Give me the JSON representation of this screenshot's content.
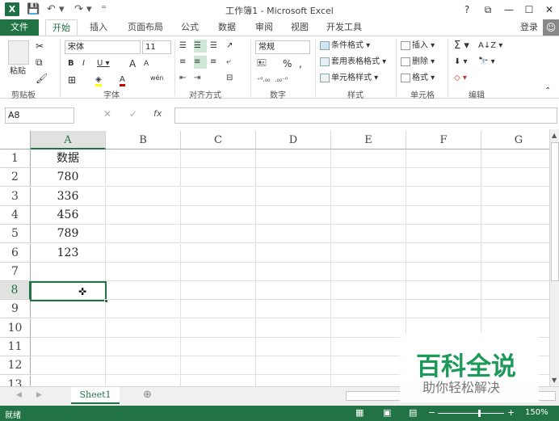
{
  "window": {
    "title": "工作簿1 - Microsoft Excel",
    "logo": "X",
    "help": "?",
    "restore": "⧉",
    "minimize": "—",
    "maximize": "☐",
    "close": "✕",
    "qa_save": "💾",
    "qa_undo": "↶ ▾",
    "qa_redo": "↷ ▾",
    "qa_more": "⁼"
  },
  "tabs": [
    "文件",
    "开始",
    "插入",
    "页面布局",
    "公式",
    "数据",
    "审阅",
    "视图",
    "开发工具"
  ],
  "login": "登录",
  "ribbon": {
    "paste": "粘贴",
    "clipboard": "剪贴板",
    "font_name": "宋体",
    "font_size": "11",
    "font_group": "字体",
    "bold": "B",
    "italic": "I",
    "underline": "U ▾",
    "grow": "A",
    "shrink": "A",
    "font_color": "A",
    "wen": "wén",
    "align_group": "对齐方式",
    "number_format": "常规",
    "number_group": "数字",
    "pct": "%",
    "comma": ",",
    "cond": "条件格式 ▾",
    "table": "套用表格格式 ▾",
    "cellstyle": "单元格样式 ▾",
    "styles_group": "样式",
    "insert": "插入 ▾",
    "delete": "删除 ▾",
    "format": "格式 ▾",
    "cells_group": "单元格",
    "sum": "Σ ▾",
    "sort": "A↓Z ▾",
    "find": "🔭 ▾",
    "fill": "⬇ ▾",
    "clear": "◇ ▾",
    "edit_group": "编辑"
  },
  "formula": {
    "namebox": "A8",
    "fx": "fx",
    "cancel": "✕",
    "enter": "✓",
    "value": ""
  },
  "columns": [
    "A",
    "B",
    "C",
    "D",
    "E",
    "F",
    "G"
  ],
  "rows": [
    "1",
    "2",
    "3",
    "4",
    "5",
    "6",
    "7",
    "8",
    "9",
    "10",
    "11",
    "12",
    "13"
  ],
  "cells": {
    "A1": "数据",
    "A2": "780",
    "A3": "336",
    "A4": "456",
    "A5": "789",
    "A6": "123"
  },
  "sheet": {
    "name": "Sheet1",
    "add": "⊕"
  },
  "status": {
    "ready": "就绪",
    "zoom": "150%",
    "minus": "−",
    "plus": "+"
  },
  "watermark": {
    "title": "百科全说",
    "sub": "助你轻松解决"
  },
  "colors": {
    "accent": "#217346",
    "selected_header": "#e1e1e1"
  }
}
